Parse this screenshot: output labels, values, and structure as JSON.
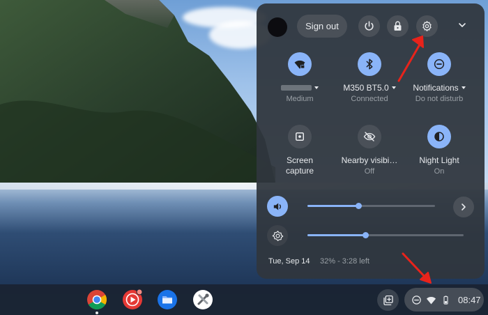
{
  "header": {
    "sign_out_label": "Sign out"
  },
  "tiles": [
    {
      "id": "wifi",
      "label": "",
      "sub": "Medium",
      "icon": "wifi-lock-icon",
      "active": true
    },
    {
      "id": "bluetooth",
      "label": "M350 BT5.0",
      "sub": "Connected",
      "icon": "bluetooth-icon",
      "active": true
    },
    {
      "id": "notifications",
      "label": "Notifications",
      "sub": "Do not disturb",
      "icon": "do-not-disturb-icon",
      "active": true
    },
    {
      "id": "screen-capture",
      "label": "Screen capture",
      "sub": "",
      "icon": "screen-capture-icon",
      "active": false
    },
    {
      "id": "nearby",
      "label": "Nearby visibi…",
      "sub": "Off",
      "icon": "visibility-off-icon",
      "active": false
    },
    {
      "id": "night-light",
      "label": "Night Light",
      "sub": "On",
      "icon": "night-light-icon",
      "active": true
    }
  ],
  "sliders": {
    "volume_level": 0.4,
    "brightness_level": 0.37
  },
  "footer": {
    "date": "Tue, Sep 14",
    "battery": "32% - 3:28 left"
  },
  "shelf": {
    "apps": [
      "chrome-icon",
      "youtube-music-icon",
      "files-icon",
      "tools-app-icon"
    ],
    "time": "08:47"
  },
  "colors": {
    "accent": "#8ab4f8",
    "panel_bg": "#30363e",
    "annotation_arrow": "#e8231b"
  }
}
